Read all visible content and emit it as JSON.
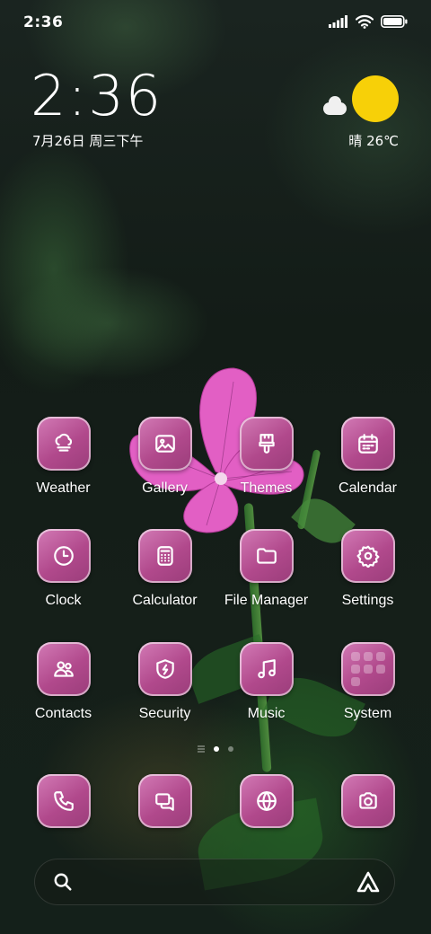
{
  "status_bar": {
    "time": "2:36"
  },
  "clock_widget": {
    "time": "2:36",
    "date": "7月26日 周三下午"
  },
  "weather_widget": {
    "text": "晴 26℃",
    "sun_color": "#f7d008"
  },
  "apps": [
    {
      "label": "Weather",
      "icon": "weather-icon"
    },
    {
      "label": "Gallery",
      "icon": "gallery-icon"
    },
    {
      "label": "Themes",
      "icon": "themes-icon"
    },
    {
      "label": "Calendar",
      "icon": "calendar-icon"
    },
    {
      "label": "Clock",
      "icon": "clock-icon"
    },
    {
      "label": "Calculator",
      "icon": "calculator-icon"
    },
    {
      "label": "File Manager",
      "icon": "folder-icon"
    },
    {
      "label": "Settings",
      "icon": "gear-icon"
    },
    {
      "label": "Contacts",
      "icon": "contacts-icon"
    },
    {
      "label": "Security",
      "icon": "shield-icon"
    },
    {
      "label": "Music",
      "icon": "music-icon"
    },
    {
      "label": "System",
      "icon": "folder-grid-icon"
    }
  ],
  "dock": [
    {
      "icon": "phone-icon"
    },
    {
      "icon": "messages-icon"
    },
    {
      "icon": "browser-icon"
    },
    {
      "icon": "camera-icon"
    }
  ],
  "pager": {
    "pages": 2,
    "current": 1
  },
  "colors": {
    "tile_accent": "#b1498c"
  }
}
